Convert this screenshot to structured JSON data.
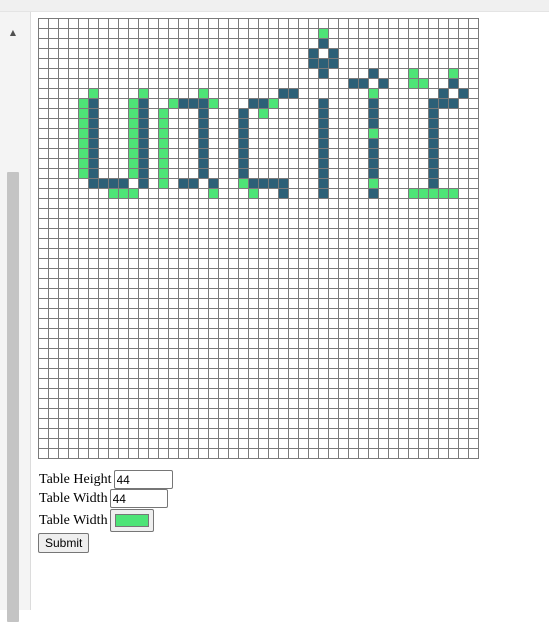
{
  "colors": {
    "teal": "#2c6077",
    "green": "#4ee477",
    "grid_line": "#7a7a7a"
  },
  "grid": {
    "rows": 44,
    "cols": 44,
    "teal_cells": [
      [
        2,
        28
      ],
      [
        3,
        27
      ],
      [
        3,
        29
      ],
      [
        4,
        27
      ],
      [
        4,
        28
      ],
      [
        4,
        29
      ],
      [
        5,
        28
      ],
      [
        5,
        33
      ],
      [
        6,
        31
      ],
      [
        6,
        32
      ],
      [
        6,
        34
      ],
      [
        7,
        33
      ],
      [
        6,
        41
      ],
      [
        7,
        40
      ],
      [
        7,
        42
      ],
      [
        8,
        39
      ],
      [
        8,
        40
      ],
      [
        8,
        41
      ],
      [
        7,
        24
      ],
      [
        7,
        25
      ],
      [
        8,
        21
      ],
      [
        8,
        22
      ],
      [
        8,
        23
      ],
      [
        9,
        20
      ],
      [
        10,
        20
      ],
      [
        11,
        20
      ],
      [
        12,
        20
      ],
      [
        13,
        20
      ],
      [
        14,
        20
      ],
      [
        15,
        20
      ],
      [
        16,
        21
      ],
      [
        16,
        22
      ],
      [
        16,
        23
      ],
      [
        16,
        24
      ],
      [
        17,
        24
      ],
      [
        7,
        10
      ],
      [
        8,
        14
      ],
      [
        8,
        15
      ],
      [
        8,
        16
      ],
      [
        9,
        10
      ],
      [
        9,
        16
      ],
      [
        10,
        10
      ],
      [
        10,
        16
      ],
      [
        11,
        10
      ],
      [
        11,
        16
      ],
      [
        12,
        10
      ],
      [
        12,
        16
      ],
      [
        13,
        10
      ],
      [
        13,
        16
      ],
      [
        14,
        10
      ],
      [
        14,
        16
      ],
      [
        15,
        10
      ],
      [
        15,
        16
      ],
      [
        16,
        10
      ],
      [
        16,
        14
      ],
      [
        16,
        15
      ],
      [
        16,
        17
      ],
      [
        8,
        28
      ],
      [
        9,
        28
      ],
      [
        10,
        28
      ],
      [
        11,
        28
      ],
      [
        12,
        28
      ],
      [
        13,
        28
      ],
      [
        14,
        28
      ],
      [
        15,
        28
      ],
      [
        16,
        28
      ],
      [
        17,
        28
      ],
      [
        8,
        33
      ],
      [
        9,
        33
      ],
      [
        10,
        33
      ],
      [
        11,
        33
      ],
      [
        12,
        33
      ],
      [
        13,
        33
      ],
      [
        14,
        33
      ],
      [
        15,
        33
      ],
      [
        16,
        33
      ],
      [
        17,
        33
      ],
      [
        9,
        39
      ],
      [
        10,
        39
      ],
      [
        11,
        39
      ],
      [
        12,
        39
      ],
      [
        13,
        39
      ],
      [
        14,
        39
      ],
      [
        15,
        39
      ],
      [
        16,
        39
      ],
      [
        8,
        5
      ],
      [
        9,
        5
      ],
      [
        10,
        5
      ],
      [
        11,
        5
      ],
      [
        12,
        5
      ],
      [
        13,
        5
      ],
      [
        14,
        5
      ],
      [
        15,
        5
      ],
      [
        16,
        5
      ],
      [
        8,
        10
      ],
      [
        16,
        6
      ],
      [
        16,
        7
      ],
      [
        16,
        8
      ],
      [
        17,
        7
      ],
      [
        17,
        8
      ]
    ],
    "green_cells": [
      [
        1,
        28
      ],
      [
        5,
        37
      ],
      [
        6,
        37
      ],
      [
        6,
        38
      ],
      [
        5,
        41
      ],
      [
        7,
        33
      ],
      [
        7,
        5
      ],
      [
        8,
        4
      ],
      [
        9,
        4
      ],
      [
        10,
        4
      ],
      [
        11,
        4
      ],
      [
        12,
        4
      ],
      [
        13,
        4
      ],
      [
        14,
        4
      ],
      [
        15,
        4
      ],
      [
        17,
        7
      ],
      [
        17,
        8
      ],
      [
        17,
        9
      ],
      [
        7,
        10
      ],
      [
        7,
        16
      ],
      [
        8,
        9
      ],
      [
        9,
        9
      ],
      [
        10,
        9
      ],
      [
        11,
        9
      ],
      [
        12,
        9
      ],
      [
        13,
        9
      ],
      [
        14,
        9
      ],
      [
        15,
        9
      ],
      [
        8,
        13
      ],
      [
        9,
        12
      ],
      [
        10,
        12
      ],
      [
        11,
        12
      ],
      [
        12,
        12
      ],
      [
        13,
        12
      ],
      [
        14,
        12
      ],
      [
        15,
        12
      ],
      [
        16,
        12
      ],
      [
        8,
        17
      ],
      [
        17,
        17
      ],
      [
        8,
        23
      ],
      [
        9,
        22
      ],
      [
        16,
        20
      ],
      [
        17,
        21
      ],
      [
        11,
        33
      ],
      [
        16,
        33
      ],
      [
        17,
        37
      ],
      [
        17,
        38
      ],
      [
        17,
        39
      ],
      [
        17,
        40
      ],
      [
        17,
        41
      ]
    ]
  },
  "form": {
    "height_label": "Table Height",
    "height_value": "44",
    "width_label": "Table Width",
    "width_value": "44",
    "color_label": "Table Width",
    "color_value": "#4ee477",
    "submit_label": "Submit"
  }
}
